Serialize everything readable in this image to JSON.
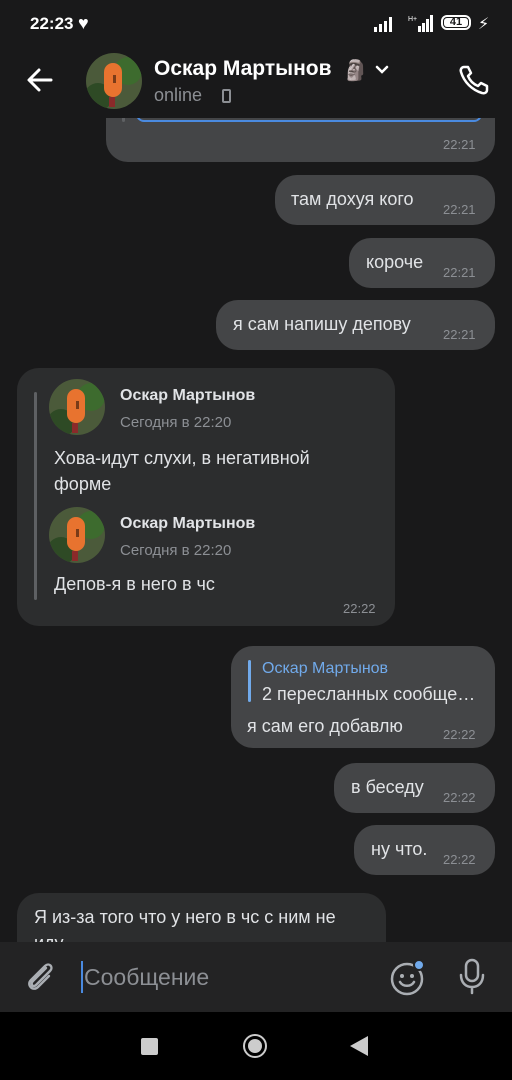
{
  "status_bar": {
    "time": "22:23",
    "battery": "41"
  },
  "header": {
    "contact_name": "Оскар Мартынов",
    "status": "online"
  },
  "messages": [
    {
      "text": "",
      "time": "22:21"
    },
    {
      "text": "там дохуя кого",
      "time": "22:21"
    },
    {
      "text": "короче",
      "time": "22:21"
    },
    {
      "text": "я сам напишу депову",
      "time": "22:21"
    },
    {
      "time": "22:22",
      "forwarded": [
        {
          "name": "Оскар Мартынов",
          "date": "Сегодня в 22:20",
          "text_lines": [
            "Хова-идут слухи, в негативной",
            "форме"
          ]
        },
        {
          "name": "Оскар Мартынов",
          "date": "Сегодня в 22:20",
          "text_lines": [
            "Депов-я в него в чс"
          ]
        }
      ]
    },
    {
      "reply": {
        "name": "Оскар Мартынов",
        "preview": "2 пересланных сообще…"
      },
      "text": "я сам его добавлю",
      "time": "22:22"
    },
    {
      "text": "в беседу",
      "time": "22:22"
    },
    {
      "text": "ну что.",
      "time": "22:22"
    },
    {
      "text_lines": [
        "Я из-за того что у него в чс с ним не",
        "иду"
      ]
    }
  ],
  "composer": {
    "placeholder": "Сообщение"
  },
  "colors": {
    "accent": "#71aaeb",
    "out_bubble": "#444547",
    "in_bubble": "#2c2d2e"
  },
  "icons": [
    "back-arrow-icon",
    "chevron-down-icon",
    "phone-call-icon",
    "paperclip-icon",
    "emoji-icon",
    "microphone-icon"
  ]
}
